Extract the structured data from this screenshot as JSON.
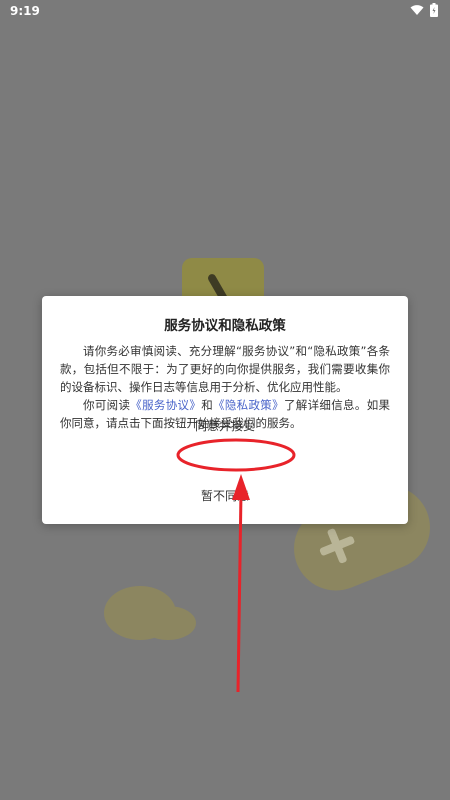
{
  "status_bar": {
    "time": "9:19"
  },
  "dialog": {
    "title": "服务协议和隐私政策",
    "para1": "请你务必审慎阅读、充分理解“服务协议”和“隐私政策”各条款，包括但不限于：为了更好的向你提供服务，我们需要收集你的设备标识、操作日志等信息用于分析、优化应用性能。",
    "para2_prefix": "你可阅读",
    "link_service": "《服务协议》",
    "para2_and": "和",
    "link_privacy": "《隐私政策》",
    "para2_suffix": "了解详细信息。如果你同意，请点击下面按钮开始接受我们的服务。",
    "agree_label": "同意并接受",
    "disagree_label": "暂不同意"
  },
  "colors": {
    "link": "#4863c9",
    "annotation": "#e8232a",
    "scrim": "#7a7a7a"
  }
}
